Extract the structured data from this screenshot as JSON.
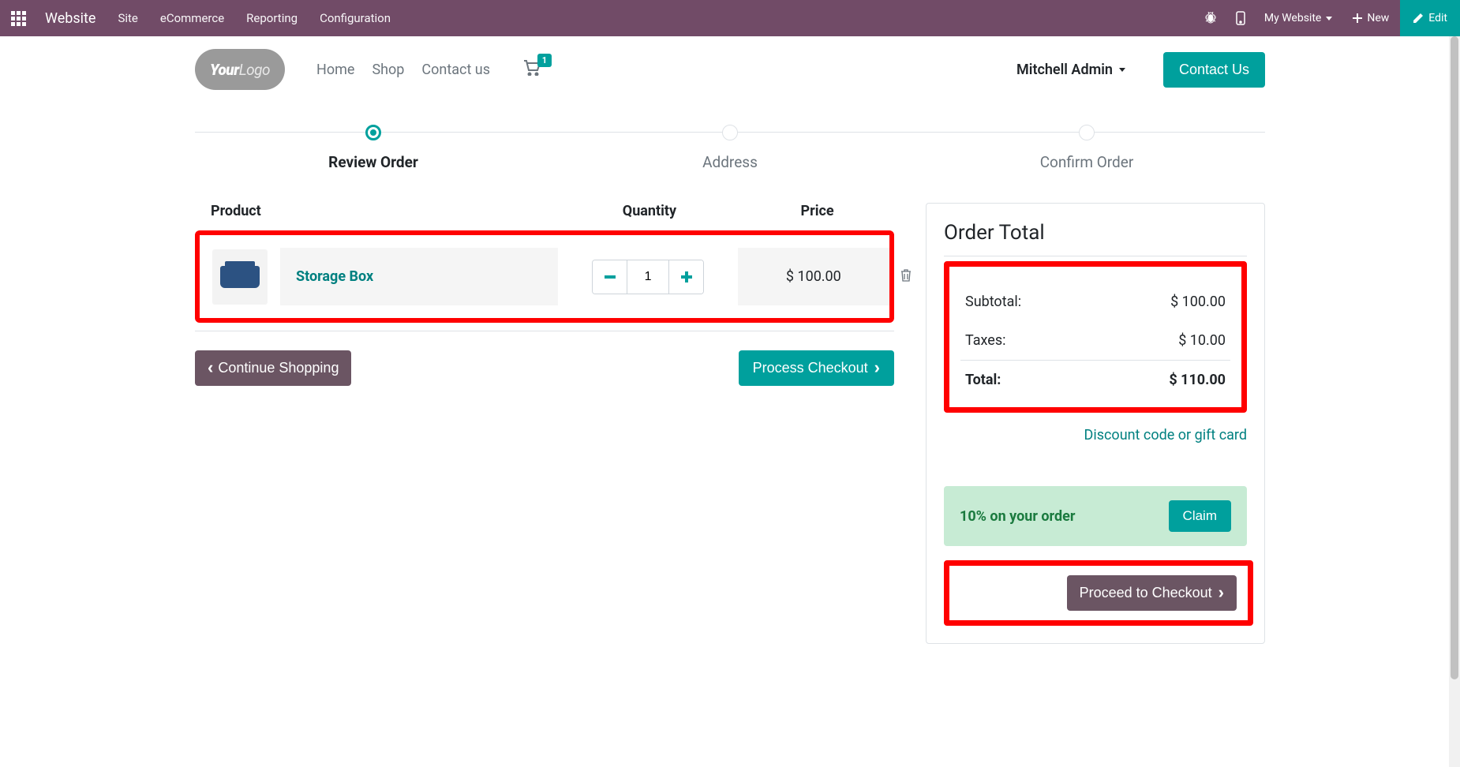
{
  "topbar": {
    "brand": "Website",
    "menu": [
      "Site",
      "eCommerce",
      "Reporting",
      "Configuration"
    ],
    "website_switch": "My Website",
    "new_label": "New",
    "edit_label": "Edit"
  },
  "header": {
    "logo_text_1": "Your",
    "logo_text_2": "Logo",
    "nav": [
      "Home",
      "Shop",
      "Contact us"
    ],
    "cart_count": "1",
    "user": "Mitchell Admin",
    "contact_btn": "Contact Us"
  },
  "steps": [
    {
      "label": "Review Order",
      "active": true
    },
    {
      "label": "Address",
      "active": false
    },
    {
      "label": "Confirm Order",
      "active": false
    }
  ],
  "cart": {
    "headers": {
      "product": "Product",
      "quantity": "Quantity",
      "price": "Price"
    },
    "item": {
      "name": "Storage Box",
      "qty": "1",
      "price": "$ 100.00"
    },
    "continue_btn": "Continue Shopping",
    "process_btn": "Process Checkout"
  },
  "summary": {
    "title": "Order Total",
    "subtotal_label": "Subtotal:",
    "subtotal_value": "$ 100.00",
    "taxes_label": "Taxes:",
    "taxes_value": "$ 10.00",
    "total_label": "Total:",
    "total_value": "$ 110.00",
    "discount_link": "Discount code or gift card",
    "promo_text": "10% on your order",
    "claim_btn": "Claim",
    "checkout_btn": "Proceed to Checkout"
  }
}
